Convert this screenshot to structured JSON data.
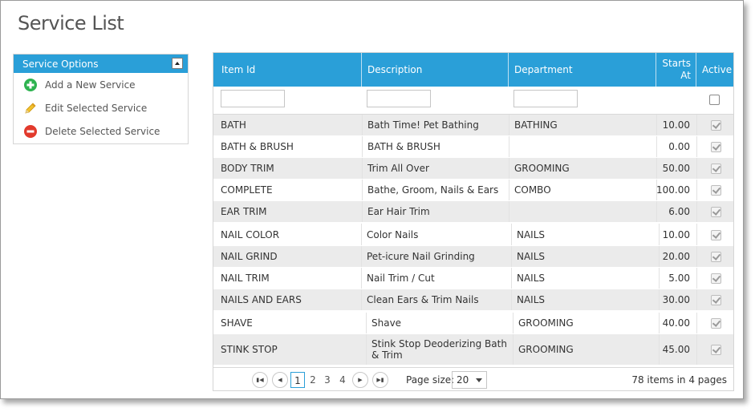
{
  "page": {
    "title": "Service List"
  },
  "sidebar": {
    "header": "Service Options",
    "items": [
      {
        "label": "Add a New Service",
        "icon": "add-icon",
        "color": "#2eb350"
      },
      {
        "label": "Edit Selected Service",
        "icon": "pencil-icon",
        "color": "#e8b30c"
      },
      {
        "label": "Delete Selected Service",
        "icon": "delete-icon",
        "color": "#e23a2c"
      }
    ]
  },
  "grid": {
    "accent": "#2a9fd8",
    "columns": {
      "item_id": "Item Id",
      "description": "Description",
      "department": "Department",
      "starts_at_line1": "Starts",
      "starts_at_line2": "At",
      "active": "Active"
    },
    "rows": [
      {
        "item_id": "BATH",
        "description": "Bath Time! Pet Bathing",
        "department": "BATHING",
        "starts_at": "10.00",
        "active": true
      },
      {
        "item_id": "BATH & BRUSH",
        "description": "BATH & BRUSH",
        "department": "",
        "starts_at": "0.00",
        "active": true
      },
      {
        "item_id": "BODY TRIM",
        "description": "Trim All Over",
        "department": "GROOMING",
        "starts_at": "50.00",
        "active": true
      },
      {
        "item_id": "COMPLETE",
        "description": "Bathe, Groom, Nails & Ears",
        "department": "COMBO",
        "starts_at": "100.00",
        "active": true
      },
      {
        "item_id": "EAR TRIM",
        "description": "Ear Hair Trim",
        "department": "",
        "starts_at": "6.00",
        "active": true
      },
      {
        "item_id": "NAIL COLOR",
        "description": "Color Nails",
        "department": "NAILS",
        "starts_at": "10.00",
        "active": true
      },
      {
        "item_id": "NAIL GRIND",
        "description": "Pet-icure Nail Grinding",
        "department": "NAILS",
        "starts_at": "20.00",
        "active": true
      },
      {
        "item_id": "NAIL TRIM",
        "description": "Nail Trim / Cut",
        "department": "NAILS",
        "starts_at": "5.00",
        "active": true
      },
      {
        "item_id": "NAILS AND EARS",
        "description": "Clean Ears & Trim Nails",
        "department": "NAILS",
        "starts_at": "30.00",
        "active": true
      },
      {
        "item_id": "SHAVE",
        "description": "Shave",
        "department": "GROOMING",
        "starts_at": "40.00",
        "active": true
      },
      {
        "item_id": "STINK STOP",
        "description": "Stink Stop Deoderizing Bath & Trim",
        "department": "GROOMING",
        "starts_at": "45.00",
        "active": true
      }
    ]
  },
  "pager": {
    "pages": [
      "1",
      "2",
      "3",
      "4"
    ],
    "current_page": "1",
    "page_size_label": "Page size:",
    "page_size": "20",
    "info": "78 items in 4 pages"
  }
}
